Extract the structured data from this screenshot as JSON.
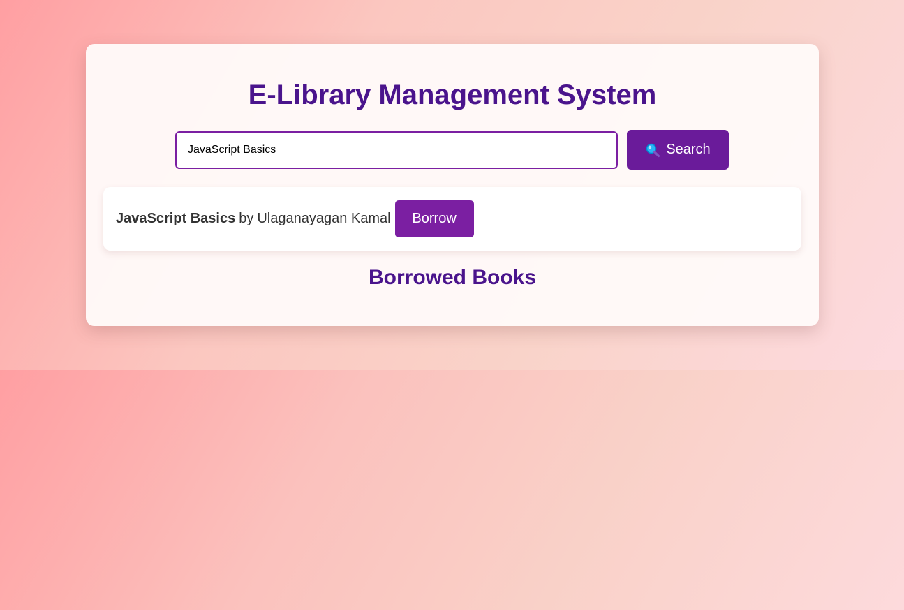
{
  "app": {
    "title": "E-Library Management System"
  },
  "search": {
    "value": "JavaScript Basics",
    "button_label": "Search",
    "icon": "search-icon"
  },
  "results": [
    {
      "title": "JavaScript Basics",
      "by": "by",
      "author": "Ulaganayagan Kamal",
      "borrow_label": "Borrow"
    }
  ],
  "borrowed": {
    "heading": "Borrowed Books"
  },
  "colors": {
    "accent": "#6a1b9a",
    "heading": "#4a148c",
    "button": "#7b1fa2"
  }
}
